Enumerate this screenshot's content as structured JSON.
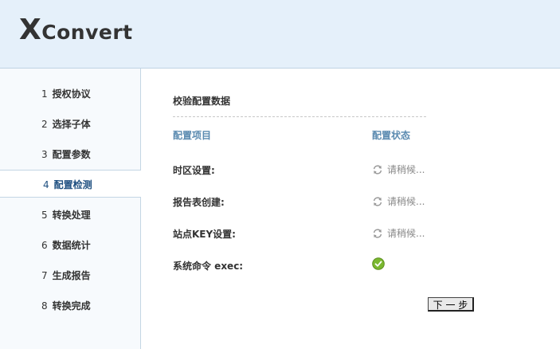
{
  "header": {
    "logo_big": "X",
    "logo_rest": "Convert"
  },
  "sidebar": {
    "items": [
      {
        "num": "1",
        "label": "授权协议"
      },
      {
        "num": "2",
        "label": "选择子体"
      },
      {
        "num": "3",
        "label": "配置参数"
      },
      {
        "num": "4",
        "label": "配置检测"
      },
      {
        "num": "5",
        "label": "转换处理"
      },
      {
        "num": "6",
        "label": "数据统计"
      },
      {
        "num": "7",
        "label": "生成报告"
      },
      {
        "num": "8",
        "label": "转换完成"
      }
    ],
    "active_index": 3
  },
  "main": {
    "title": "校验配置数据",
    "col_item": "配置项目",
    "col_status": "配置状态",
    "rows": [
      {
        "label": "时区设置:",
        "status": "请稍候..."
      },
      {
        "label": "报告表创建:",
        "status": "请稍候..."
      },
      {
        "label": "站点KEY设置:",
        "status": "请稍候..."
      },
      {
        "label": "系统命令 exec:",
        "status": ""
      }
    ],
    "next_button": "下 一 步"
  },
  "colors": {
    "accent": "#1e4f80",
    "header_bg": "#e5f0fa",
    "ok_green": "#7ab82f",
    "column_head": "#5a8ab0"
  }
}
